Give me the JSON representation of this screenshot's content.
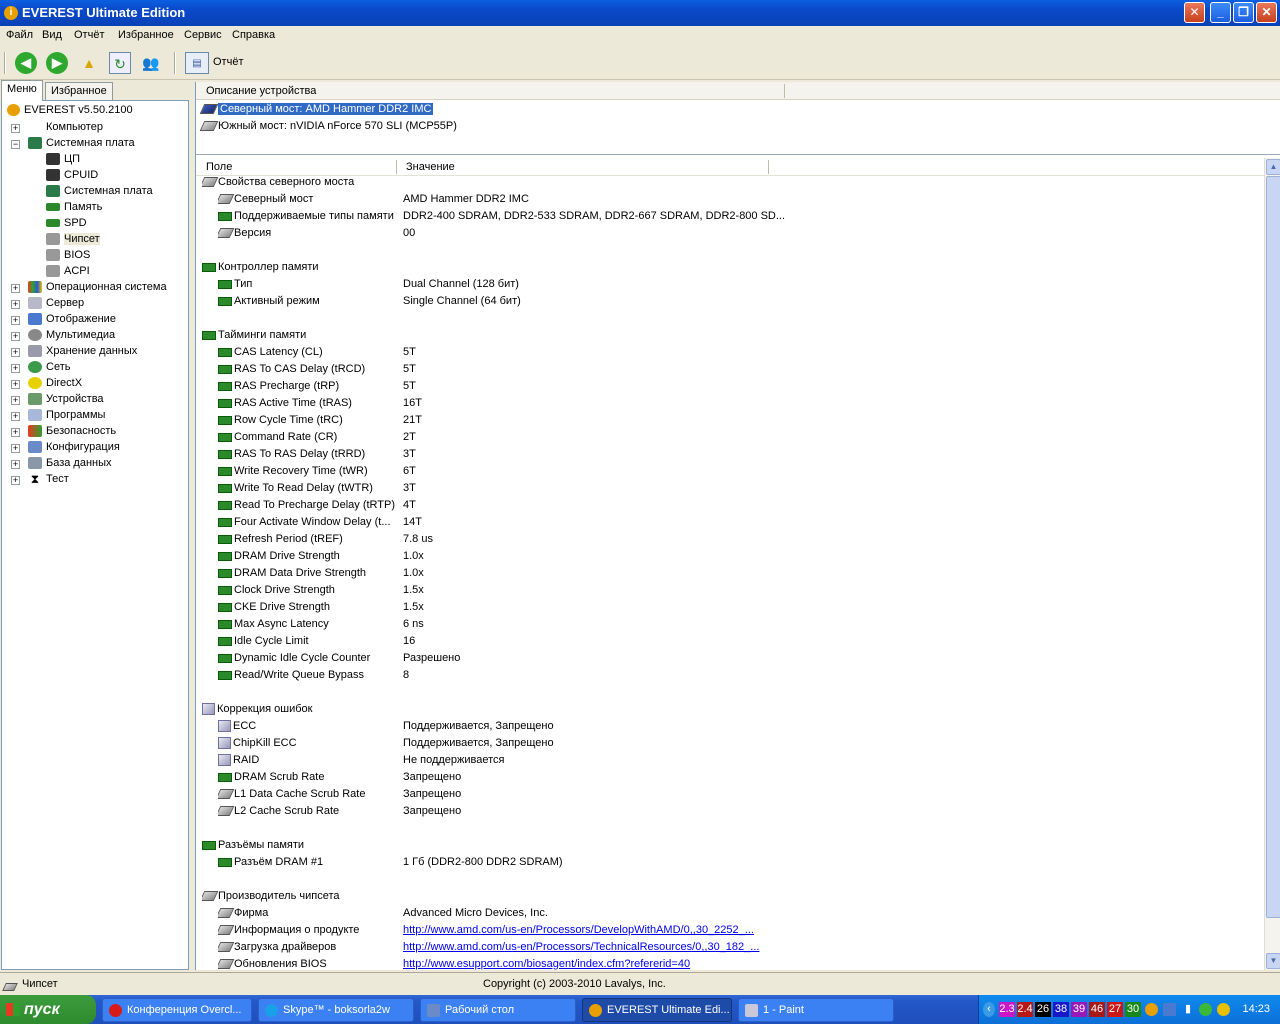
{
  "window": {
    "title": "EVEREST Ultimate Edition"
  },
  "menu": [
    "Файл",
    "Вид",
    "Отчёт",
    "Избранное",
    "Сервис",
    "Справка"
  ],
  "toolbar": {
    "report_label": "Отчёт"
  },
  "tabs": {
    "menu": "Меню",
    "favorites": "Избранное"
  },
  "tree": {
    "root": "EVEREST v5.50.2100",
    "items": [
      "Компьютер",
      "Системная плата",
      "ЦП",
      "CPUID",
      "Системная плата",
      "Память",
      "SPD",
      "Чипсет",
      "BIOS",
      "ACPI",
      "Операционная система",
      "Сервер",
      "Отображение",
      "Мультимедиа",
      "Хранение данных",
      "Сеть",
      "DirectX",
      "Устройства",
      "Программы",
      "Безопасность",
      "Конфигурация",
      "База данных",
      "Тест"
    ]
  },
  "devices": {
    "header": "Описание устройства",
    "items": [
      "Северный мост: AMD Hammer DDR2 IMC",
      "Южный мост: nVIDIA nForce 570 SLI (MCP55P)"
    ]
  },
  "props": {
    "header_field": "Поле",
    "header_value": "Значение",
    "rows": [
      {
        "f": "Свойства северного моста",
        "v": "",
        "g": true,
        "i": "c"
      },
      {
        "f": "Северный мост",
        "v": "AMD Hammer DDR2 IMC",
        "i": "c"
      },
      {
        "f": "Поддерживаемые типы памяти",
        "v": "DDR2-400 SDRAM, DDR2-533 SDRAM, DDR2-667 SDRAM, DDR2-800 SD...",
        "i": "m"
      },
      {
        "f": "Версия",
        "v": "00",
        "i": "c"
      },
      {
        "f": "",
        "v": ""
      },
      {
        "f": "Контроллер памяти",
        "v": "",
        "g": true,
        "i": "m"
      },
      {
        "f": "Тип",
        "v": "Dual Channel  (128 бит)",
        "i": "m"
      },
      {
        "f": "Активный режим",
        "v": "Single Channel  (64 бит)",
        "i": "m"
      },
      {
        "f": "",
        "v": ""
      },
      {
        "f": "Тайминги памяти",
        "v": "",
        "g": true,
        "i": "m"
      },
      {
        "f": "CAS Latency (CL)",
        "v": "5T",
        "i": "m"
      },
      {
        "f": "RAS To CAS Delay (tRCD)",
        "v": "5T",
        "i": "m"
      },
      {
        "f": "RAS Precharge (tRP)",
        "v": "5T",
        "i": "m"
      },
      {
        "f": "RAS Active Time (tRAS)",
        "v": "16T",
        "i": "m"
      },
      {
        "f": "Row Cycle Time (tRC)",
        "v": "21T",
        "i": "m"
      },
      {
        "f": "Command Rate (CR)",
        "v": "2T",
        "i": "m"
      },
      {
        "f": "RAS To RAS Delay (tRRD)",
        "v": "3T",
        "i": "m"
      },
      {
        "f": "Write Recovery Time (tWR)",
        "v": "6T",
        "i": "m"
      },
      {
        "f": "Write To Read Delay (tWTR)",
        "v": "3T",
        "i": "m"
      },
      {
        "f": "Read To Precharge Delay (tRTP)",
        "v": "4T",
        "i": "m"
      },
      {
        "f": "Four Activate Window Delay (t...",
        "v": "14T",
        "i": "m"
      },
      {
        "f": "Refresh Period (tREF)",
        "v": "7.8 us",
        "i": "m"
      },
      {
        "f": "DRAM Drive Strength",
        "v": "1.0x",
        "i": "m"
      },
      {
        "f": "DRAM Data Drive Strength",
        "v": "1.0x",
        "i": "m"
      },
      {
        "f": "Clock Drive Strength",
        "v": "1.5x",
        "i": "m"
      },
      {
        "f": "CKE Drive Strength",
        "v": "1.5x",
        "i": "m"
      },
      {
        "f": "Max Async Latency",
        "v": "6 ns",
        "i": "m"
      },
      {
        "f": "Idle Cycle Limit",
        "v": "16",
        "i": "m"
      },
      {
        "f": "Dynamic Idle Cycle Counter",
        "v": "Разрешено",
        "i": "m"
      },
      {
        "f": "Read/Write Queue Bypass",
        "v": "8",
        "i": "m"
      },
      {
        "f": "",
        "v": ""
      },
      {
        "f": "Коррекция ошибок",
        "v": "",
        "g": true,
        "i": "b"
      },
      {
        "f": "ECC",
        "v": "Поддерживается, Запрещено",
        "i": "b"
      },
      {
        "f": "ChipKill ECC",
        "v": "Поддерживается, Запрещено",
        "i": "b"
      },
      {
        "f": "RAID",
        "v": "Не поддерживается",
        "i": "b"
      },
      {
        "f": "DRAM Scrub Rate",
        "v": "Запрещено",
        "i": "m"
      },
      {
        "f": "L1 Data Cache Scrub Rate",
        "v": "Запрещено",
        "i": "c"
      },
      {
        "f": "L2 Cache Scrub Rate",
        "v": "Запрещено",
        "i": "c"
      },
      {
        "f": "",
        "v": ""
      },
      {
        "f": "Разъёмы памяти",
        "v": "",
        "g": true,
        "i": "m"
      },
      {
        "f": "Разъём DRAM #1",
        "v": "1 Гб  (DDR2-800 DDR2 SDRAM)",
        "i": "m"
      },
      {
        "f": "",
        "v": ""
      },
      {
        "f": "Производитель чипсета",
        "v": "",
        "g": true,
        "i": "c"
      },
      {
        "f": "Фирма",
        "v": "Advanced Micro Devices, Inc.",
        "i": "c"
      },
      {
        "f": "Информация о продукте",
        "v": "http://www.amd.com/us-en/Processors/DevelopWithAMD/0,,30_2252_...",
        "i": "c",
        "link": true
      },
      {
        "f": "Загрузка драйверов",
        "v": "http://www.amd.com/us-en/Processors/TechnicalResources/0,,30_182_...",
        "i": "c",
        "link": true
      },
      {
        "f": "Обновления BIOS",
        "v": "http://www.esupport.com/biosagent/index.cfm?refererid=40",
        "i": "c",
        "link": true
      }
    ]
  },
  "status": {
    "left": "Чипсет",
    "center": "Copyright (c) 2003-2010 Lavalys, Inc."
  },
  "taskbar": {
    "start": "пуск",
    "tasks": [
      "Конференция Overcl...",
      "Skype™ - boksorla2w",
      "Рабочий стол",
      "EVEREST Ultimate Edi...",
      "1 - Paint"
    ],
    "tray_numbers": [
      "2.3",
      "2.4",
      "26",
      "38",
      "39",
      "46",
      "27",
      "30"
    ],
    "clock": "14:23"
  }
}
